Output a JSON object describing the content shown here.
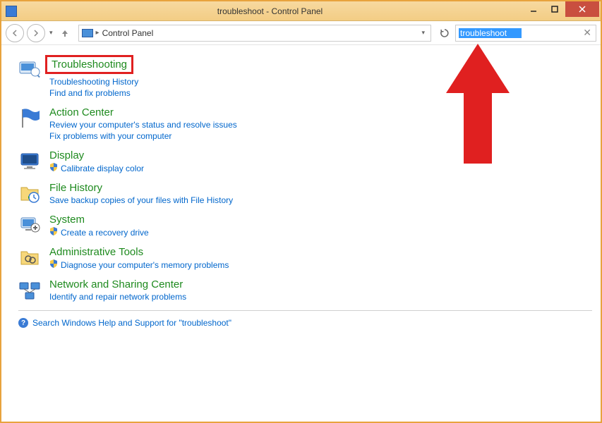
{
  "window": {
    "title": "troubleshoot - Control Panel"
  },
  "nav": {
    "breadcrumb": "Control Panel",
    "search_value": "troubleshoot"
  },
  "results": [
    {
      "title": "Troubleshooting",
      "highlighted": true,
      "icon": "troubleshooting",
      "sublinks": [
        {
          "label": "Troubleshooting History",
          "shield": false
        },
        {
          "label": "Find and fix problems",
          "shield": false
        }
      ]
    },
    {
      "title": "Action Center",
      "icon": "flag",
      "sublinks": [
        {
          "label": "Review your computer's status and resolve issues",
          "shield": false
        },
        {
          "label": "Fix problems with your computer",
          "shield": false
        }
      ]
    },
    {
      "title": "Display",
      "icon": "display",
      "sublinks": [
        {
          "label": "Calibrate display color",
          "shield": true
        }
      ]
    },
    {
      "title": "File History",
      "icon": "file-history",
      "sublinks": [
        {
          "label": "Save backup copies of your files with File History",
          "shield": false
        }
      ]
    },
    {
      "title": "System",
      "icon": "system",
      "sublinks": [
        {
          "label": "Create a recovery drive",
          "shield": true
        }
      ]
    },
    {
      "title": "Administrative Tools",
      "icon": "admin-tools",
      "sublinks": [
        {
          "label": "Diagnose your computer's memory problems",
          "shield": true
        }
      ]
    },
    {
      "title": "Network and Sharing Center",
      "icon": "network",
      "sublinks": [
        {
          "label": "Identify and repair network problems",
          "shield": false
        }
      ]
    }
  ],
  "help_link": "Search Windows Help and Support for \"troubleshoot\""
}
